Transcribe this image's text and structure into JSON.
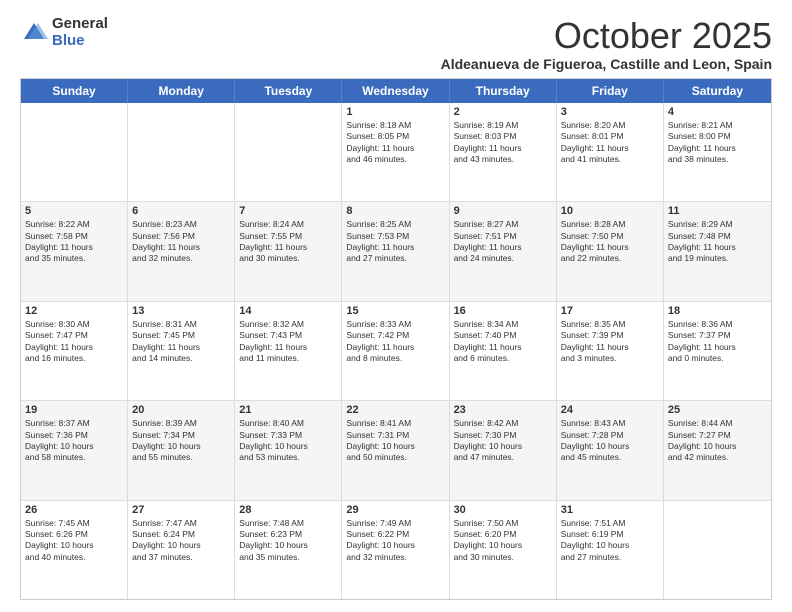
{
  "logo": {
    "general": "General",
    "blue": "Blue"
  },
  "header": {
    "month": "October 2025",
    "location": "Aldeanueva de Figueroa, Castille and Leon, Spain"
  },
  "weekdays": [
    "Sunday",
    "Monday",
    "Tuesday",
    "Wednesday",
    "Thursday",
    "Friday",
    "Saturday"
  ],
  "rows": [
    {
      "alt": false,
      "cells": [
        {
          "day": "",
          "info": ""
        },
        {
          "day": "",
          "info": ""
        },
        {
          "day": "",
          "info": ""
        },
        {
          "day": "1",
          "info": "Sunrise: 8:18 AM\nSunset: 8:05 PM\nDaylight: 11 hours\nand 46 minutes."
        },
        {
          "day": "2",
          "info": "Sunrise: 8:19 AM\nSunset: 8:03 PM\nDaylight: 11 hours\nand 43 minutes."
        },
        {
          "day": "3",
          "info": "Sunrise: 8:20 AM\nSunset: 8:01 PM\nDaylight: 11 hours\nand 41 minutes."
        },
        {
          "day": "4",
          "info": "Sunrise: 8:21 AM\nSunset: 8:00 PM\nDaylight: 11 hours\nand 38 minutes."
        }
      ]
    },
    {
      "alt": true,
      "cells": [
        {
          "day": "5",
          "info": "Sunrise: 8:22 AM\nSunset: 7:58 PM\nDaylight: 11 hours\nand 35 minutes."
        },
        {
          "day": "6",
          "info": "Sunrise: 8:23 AM\nSunset: 7:56 PM\nDaylight: 11 hours\nand 32 minutes."
        },
        {
          "day": "7",
          "info": "Sunrise: 8:24 AM\nSunset: 7:55 PM\nDaylight: 11 hours\nand 30 minutes."
        },
        {
          "day": "8",
          "info": "Sunrise: 8:25 AM\nSunset: 7:53 PM\nDaylight: 11 hours\nand 27 minutes."
        },
        {
          "day": "9",
          "info": "Sunrise: 8:27 AM\nSunset: 7:51 PM\nDaylight: 11 hours\nand 24 minutes."
        },
        {
          "day": "10",
          "info": "Sunrise: 8:28 AM\nSunset: 7:50 PM\nDaylight: 11 hours\nand 22 minutes."
        },
        {
          "day": "11",
          "info": "Sunrise: 8:29 AM\nSunset: 7:48 PM\nDaylight: 11 hours\nand 19 minutes."
        }
      ]
    },
    {
      "alt": false,
      "cells": [
        {
          "day": "12",
          "info": "Sunrise: 8:30 AM\nSunset: 7:47 PM\nDaylight: 11 hours\nand 16 minutes."
        },
        {
          "day": "13",
          "info": "Sunrise: 8:31 AM\nSunset: 7:45 PM\nDaylight: 11 hours\nand 14 minutes."
        },
        {
          "day": "14",
          "info": "Sunrise: 8:32 AM\nSunset: 7:43 PM\nDaylight: 11 hours\nand 11 minutes."
        },
        {
          "day": "15",
          "info": "Sunrise: 8:33 AM\nSunset: 7:42 PM\nDaylight: 11 hours\nand 8 minutes."
        },
        {
          "day": "16",
          "info": "Sunrise: 8:34 AM\nSunset: 7:40 PM\nDaylight: 11 hours\nand 6 minutes."
        },
        {
          "day": "17",
          "info": "Sunrise: 8:35 AM\nSunset: 7:39 PM\nDaylight: 11 hours\nand 3 minutes."
        },
        {
          "day": "18",
          "info": "Sunrise: 8:36 AM\nSunset: 7:37 PM\nDaylight: 11 hours\nand 0 minutes."
        }
      ]
    },
    {
      "alt": true,
      "cells": [
        {
          "day": "19",
          "info": "Sunrise: 8:37 AM\nSunset: 7:36 PM\nDaylight: 10 hours\nand 58 minutes."
        },
        {
          "day": "20",
          "info": "Sunrise: 8:39 AM\nSunset: 7:34 PM\nDaylight: 10 hours\nand 55 minutes."
        },
        {
          "day": "21",
          "info": "Sunrise: 8:40 AM\nSunset: 7:33 PM\nDaylight: 10 hours\nand 53 minutes."
        },
        {
          "day": "22",
          "info": "Sunrise: 8:41 AM\nSunset: 7:31 PM\nDaylight: 10 hours\nand 50 minutes."
        },
        {
          "day": "23",
          "info": "Sunrise: 8:42 AM\nSunset: 7:30 PM\nDaylight: 10 hours\nand 47 minutes."
        },
        {
          "day": "24",
          "info": "Sunrise: 8:43 AM\nSunset: 7:28 PM\nDaylight: 10 hours\nand 45 minutes."
        },
        {
          "day": "25",
          "info": "Sunrise: 8:44 AM\nSunset: 7:27 PM\nDaylight: 10 hours\nand 42 minutes."
        }
      ]
    },
    {
      "alt": false,
      "cells": [
        {
          "day": "26",
          "info": "Sunrise: 7:45 AM\nSunset: 6:26 PM\nDaylight: 10 hours\nand 40 minutes."
        },
        {
          "day": "27",
          "info": "Sunrise: 7:47 AM\nSunset: 6:24 PM\nDaylight: 10 hours\nand 37 minutes."
        },
        {
          "day": "28",
          "info": "Sunrise: 7:48 AM\nSunset: 6:23 PM\nDaylight: 10 hours\nand 35 minutes."
        },
        {
          "day": "29",
          "info": "Sunrise: 7:49 AM\nSunset: 6:22 PM\nDaylight: 10 hours\nand 32 minutes."
        },
        {
          "day": "30",
          "info": "Sunrise: 7:50 AM\nSunset: 6:20 PM\nDaylight: 10 hours\nand 30 minutes."
        },
        {
          "day": "31",
          "info": "Sunrise: 7:51 AM\nSunset: 6:19 PM\nDaylight: 10 hours\nand 27 minutes."
        },
        {
          "day": "",
          "info": ""
        }
      ]
    }
  ]
}
